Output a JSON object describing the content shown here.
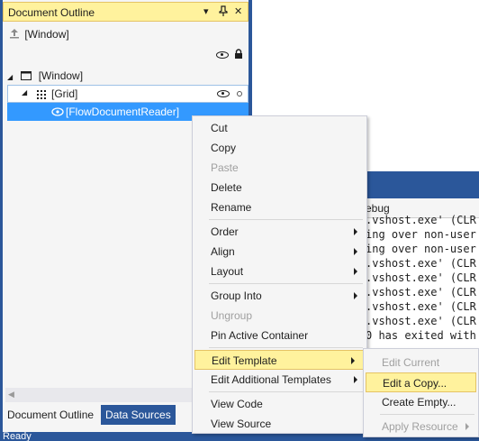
{
  "outline": {
    "title": "Document Outline",
    "header_buttons": [
      "▾",
      "✂",
      "✕"
    ],
    "root_label": "[Window]",
    "tree": [
      {
        "label": "[Window]",
        "expander": "◢"
      },
      {
        "label": "[Grid]",
        "expander": "◢"
      },
      {
        "label": "[FlowDocumentReader]"
      }
    ],
    "tabs": [
      "Document Outline",
      "Data Sources"
    ]
  },
  "status": {
    "text": "Ready"
  },
  "output": {
    "source_label": "ebug",
    "lines": [
      ".vshost.exe' (CLR",
      "ing over non-user",
      "ing over non-user",
      ".vshost.exe' (CLR",
      ".vshost.exe' (CLR",
      ".vshost.exe' (CLR",
      ".vshost.exe' (CLR",
      ".vshost.exe' (CLR",
      "0 has exited with"
    ]
  },
  "context_menu": {
    "items": [
      {
        "label": "Cut",
        "enabled": true
      },
      {
        "label": "Copy",
        "enabled": true
      },
      {
        "label": "Paste",
        "enabled": false
      },
      {
        "label": "Delete",
        "enabled": true
      },
      {
        "label": "Rename",
        "enabled": true
      },
      {
        "label": "Order",
        "enabled": true,
        "submenu": true
      },
      {
        "label": "Align",
        "enabled": true,
        "submenu": true
      },
      {
        "label": "Layout",
        "enabled": true,
        "submenu": true
      },
      {
        "label": "Group Into",
        "enabled": true,
        "submenu": true
      },
      {
        "label": "Ungroup",
        "enabled": false
      },
      {
        "label": "Pin Active Container",
        "enabled": true
      },
      {
        "label": "Edit Template",
        "enabled": true,
        "submenu": true,
        "highlighted": true
      },
      {
        "label": "Edit Additional Templates",
        "enabled": true,
        "submenu": true
      },
      {
        "label": "View Code",
        "enabled": true
      },
      {
        "label": "View Source",
        "enabled": true
      }
    ]
  },
  "submenu": {
    "items": [
      {
        "label": "Edit Current",
        "enabled": false
      },
      {
        "label": "Edit a Copy...",
        "enabled": true,
        "highlighted": true
      },
      {
        "label": "Create Empty...",
        "enabled": true
      },
      {
        "label": "Apply Resource",
        "enabled": false,
        "submenu": true
      }
    ]
  },
  "colors": {
    "accent": "#2b579a",
    "selection": "#3399ff",
    "highlight": "#fff29d",
    "disabled_text": "#a0a0a0"
  }
}
